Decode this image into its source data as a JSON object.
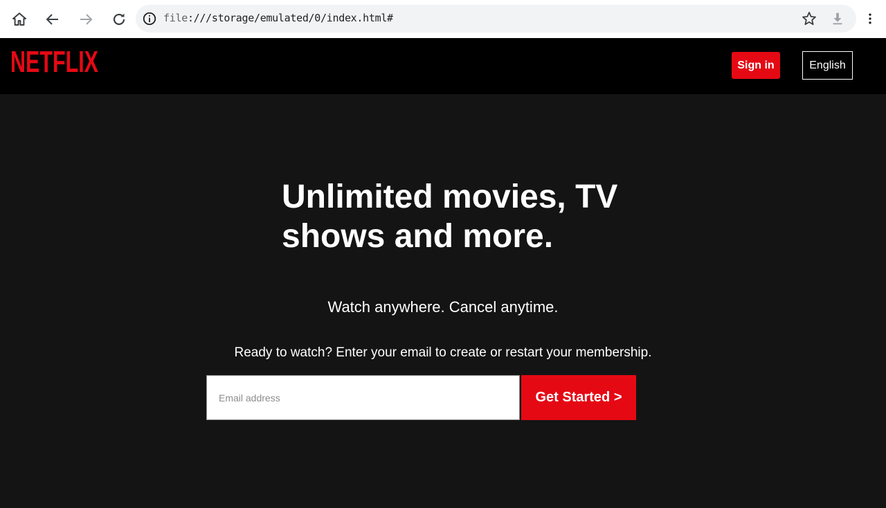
{
  "browser": {
    "url_scheme": "file",
    "url_rest": ":///storage/emulated/0/index.html#",
    "icons": {
      "home": "home-icon",
      "back": "back-arrow-icon",
      "forward": "forward-arrow-icon",
      "reload": "reload-icon",
      "info": "info-icon",
      "bookmark": "star-icon",
      "download": "download-icon",
      "menu": "more-vert-icon"
    }
  },
  "header": {
    "logo_text": "NETFLIX",
    "signin_label": "Sign in",
    "language_label": "English"
  },
  "hero": {
    "title": "Unlimited movies, TV shows and more.",
    "subtitle": "Watch anywhere. Cancel anytime.",
    "cta_text": "Ready to watch? Enter your email to create or restart your membership.",
    "email_placeholder": "Email address",
    "email_value": "",
    "get_started_label": "Get Started >"
  },
  "colors": {
    "brand_red": "#e50914",
    "page_bg": "#141414",
    "header_bg": "#000000"
  }
}
